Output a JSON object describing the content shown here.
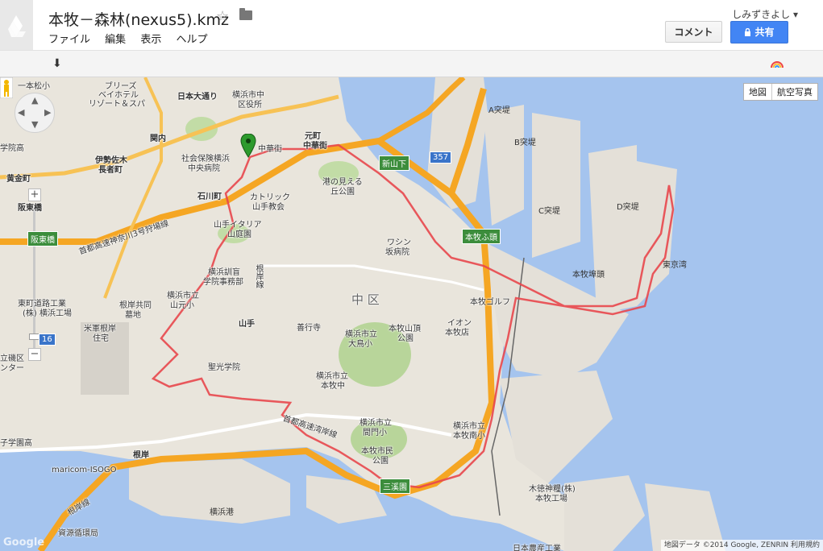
{
  "header": {
    "title": "本牧－森林(nexus5).kmz",
    "menu": [
      "ファイル",
      "編集",
      "表示",
      "ヘルプ"
    ],
    "user": "しみずきよし ▾",
    "comment_label": "コメント",
    "share_label": "共有"
  },
  "toolbar": {
    "download_icon": "⬇",
    "extension_icon": "rainbow-icon"
  },
  "map_controls": {
    "map_label": "地図",
    "satellite_label": "航空写真",
    "zoom_in": "+",
    "zoom_out": "−"
  },
  "labels": {
    "l1": "一本松小",
    "l2": "ブリーズ",
    "l3": "ベイホテル",
    "l4": "リゾート＆スパ",
    "l5": "日本大通り",
    "l6": "横浜市中",
    "l7": "区役所",
    "l8": "学院高",
    "l9": "関内",
    "l10": "伊勢佐木",
    "l11": "長者町",
    "l12": "黄金町",
    "l13": "社会保険横浜",
    "l14": "中央病院",
    "l15": "中華街",
    "l16": "元町",
    "l17": "中華街",
    "l18": "港の見える",
    "l19": "丘公園",
    "l20": "A突堤",
    "l21": "B突堤",
    "l22": "C突堤",
    "l23": "D突堤",
    "l24": "石川町",
    "l25": "カトリック",
    "l26": "山手教会",
    "l27": "阪東橋",
    "l28": "首都高速神奈川3号狩場線",
    "l29": "山手イタリア",
    "l30": "山庭園",
    "l31": "ワシン",
    "l32": "坂病院",
    "l33": "本牧埠頭",
    "l34": "東京湾",
    "l35": "横浜訓盲",
    "l36": "学院事務部",
    "l37": "根岸線",
    "l38": "中 区",
    "l39": "本牧ゴルフ",
    "l40": "東町道路工業",
    "l41": "(株) 横浜工場",
    "l42": "根岸共同",
    "l43": "墓地",
    "l44": "横浜市立",
    "l45": "山元小",
    "l46": "米軍根岸",
    "l47": "住宅",
    "l48": "山手",
    "l49": "善行寺",
    "l50": "横浜市立",
    "l51": "大鳥小",
    "l52": "本牧山頂",
    "l53": "公園",
    "l54": "イオン",
    "l55": "本牧店",
    "l56": "聖光学院",
    "l57": "横浜市立",
    "l58": "本牧中",
    "l59": "立磯区",
    "l60": "ンター",
    "l61": "首都高速湾岸線",
    "l62": "横浜市立",
    "l63": "間門小",
    "l64": "横浜市立",
    "l65": "本牧南小",
    "l66": "本牧市民",
    "l67": "公園",
    "l68": "子学園高",
    "l69": "根岸",
    "l70": "maricom-ISOGO",
    "l71": "根岸線",
    "l72": "木徳神糧(株)",
    "l73": "本牧工場",
    "l74": "横浜港",
    "l75": "資源循環局",
    "l76": "日本農産工業"
  },
  "signs": {
    "s1": "阪東橋",
    "s2": "新山下",
    "s3": "本牧ふ頭",
    "s4": "三溪園",
    "s5": "357",
    "s6": "16"
  },
  "attribution": "地図データ ©2014 Google, ZENRIN   利用規約",
  "google_logo": "Google"
}
